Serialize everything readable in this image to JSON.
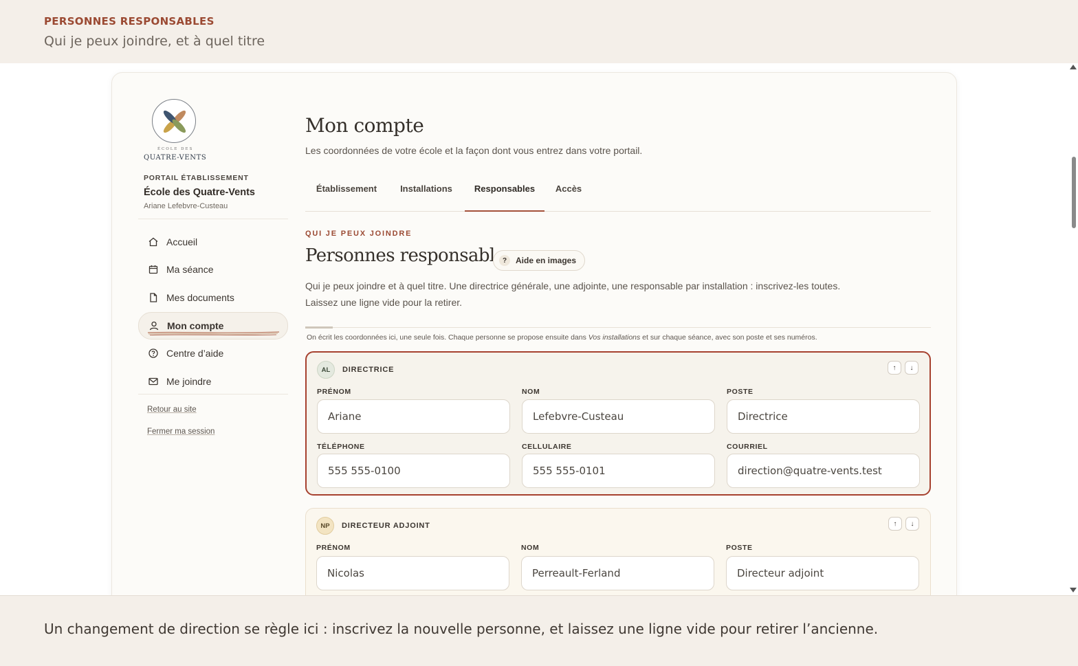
{
  "caption": {
    "eyebrow": "PERSONNES RESPONSABLES",
    "subtitle": "Qui je peux joindre, et à quel titre",
    "footer": "Un changement de direction se règle ici : inscrivez la nouvelle personne, et laissez une ligne vide pour retirer l’ancienne."
  },
  "sidebar": {
    "logo_small": "ÉCOLE DES",
    "logo_name": "QUATRE-VENTS",
    "portal_label": "PORTAIL ÉTABLISSEMENT",
    "school": "École des Quatre-Vents",
    "person": "Ariane Lefebvre-Custeau",
    "items": [
      {
        "label": "Accueil",
        "icon": "home-icon"
      },
      {
        "label": "Ma séance",
        "icon": "calendar-icon"
      },
      {
        "label": "Mes documents",
        "icon": "document-icon"
      },
      {
        "label": "Mon compte",
        "icon": "user-icon",
        "active": true
      },
      {
        "label": "Centre d’aide",
        "icon": "help-circle-icon"
      },
      {
        "label": "Me joindre",
        "icon": "mail-icon"
      }
    ],
    "links": [
      "Retour au site",
      "Fermer ma session"
    ]
  },
  "main": {
    "title": "Mon compte",
    "lead": "Les coordonnées de votre école et la façon dont vous entrez dans votre portail.",
    "tabs": [
      {
        "label": "Établissement"
      },
      {
        "label": "Installations"
      },
      {
        "label": "Responsables",
        "active": true
      },
      {
        "label": "Accès"
      }
    ],
    "section_eyebrow": "QUI JE PEUX JOINDRE",
    "section_title": "Personnes responsables",
    "help_label": "Aide en images",
    "help_q": "?",
    "desc_line1": "Qui je peux joindre et à quel titre. Une directrice générale, une adjointe, une responsable par installation : inscrivez-les toutes.",
    "desc_line2": "Laissez une ligne vide pour la retirer.",
    "note_before": "On écrit les coordonnées ici, une seule fois. Chaque personne se propose ensuite dans ",
    "note_em": "Vos installations",
    "note_after": " et sur chaque séance, avec son poste et ses numéros."
  },
  "labels": {
    "prenom": "PRÉNOM",
    "nom": "NOM",
    "poste": "POSTE",
    "telephone": "TÉLÉPHONE",
    "cellulaire": "CELLULAIRE",
    "courriel": "COURRIEL",
    "up": "↑",
    "down": "↓"
  },
  "people": [
    {
      "initials": "AL",
      "role": "DIRECTRICE",
      "prenom": "Ariane",
      "nom": "Lefebvre-Custeau",
      "poste": "Directrice",
      "telephone": "555 555-0100",
      "cellulaire": "555 555-0101",
      "courriel": "direction@quatre-vents.test"
    },
    {
      "initials": "NP",
      "role": "DIRECTEUR ADJOINT",
      "prenom": "Nicolas",
      "nom": "Perreault-Ferland",
      "poste": "Directeur adjoint"
    }
  ],
  "colors": {
    "accent": "#9b4a33",
    "selected_border": "#a6402e",
    "background": "#f4efe9"
  }
}
